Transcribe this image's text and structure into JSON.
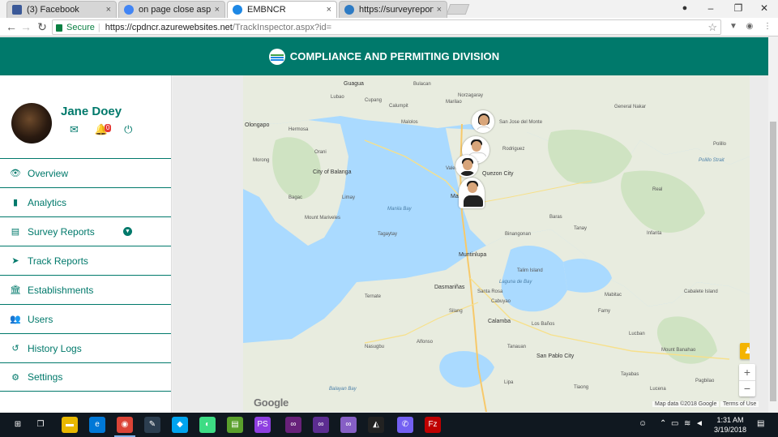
{
  "browser": {
    "tabs": [
      {
        "label": "(3) Facebook",
        "favicon": "facebook-icon",
        "color": "#3b5998"
      },
      {
        "label": "on page close asp.net - G",
        "favicon": "google-icon",
        "color": "#4285f4"
      },
      {
        "label": "EMBNCR",
        "favicon": "emb-logo-icon",
        "color": "#1e88e5"
      },
      {
        "label": "https://surveyreportform",
        "favicon": "globe-icon",
        "color": "#2e7bc4"
      }
    ],
    "tab_close": "×",
    "window_controls": {
      "minimize": "–",
      "maximize": "❐",
      "close": "✕"
    },
    "address": {
      "secure_label": "Secure",
      "host": "https://cpdncr.azurewebsites.net",
      "path": "/TrackInspector.aspx?id="
    }
  },
  "header": {
    "title": "COMPLIANCE AND PERMITING DIVISION"
  },
  "user": {
    "name": "Jane Doey",
    "notification_count": "0"
  },
  "menu": [
    {
      "label": "Overview",
      "icon": "👁"
    },
    {
      "label": "Analytics",
      "icon": "▮"
    },
    {
      "label": "Survey Reports",
      "icon": "▤"
    },
    {
      "label": "Track Reports",
      "icon": "➤"
    },
    {
      "label": "Establishments",
      "icon": "🏛"
    },
    {
      "label": "Users",
      "icon": "👥"
    },
    {
      "label": "History Logs",
      "icon": "↺"
    },
    {
      "label": "Settings",
      "icon": "⚙"
    }
  ],
  "map": {
    "labels": [
      {
        "text": "Guagua",
        "cls": "big"
      },
      {
        "text": "Bulacan",
        "cls": ""
      },
      {
        "text": "Lubao",
        "cls": ""
      },
      {
        "text": "Cupang",
        "cls": ""
      },
      {
        "text": "Calumpit",
        "cls": ""
      },
      {
        "text": "Marilao",
        "cls": ""
      },
      {
        "text": "Olongapo",
        "cls": "big"
      },
      {
        "text": "Hermosa",
        "cls": ""
      },
      {
        "text": "Malolos",
        "cls": ""
      },
      {
        "text": "Norzagaray",
        "cls": ""
      },
      {
        "text": "San Jose del Monte",
        "cls": ""
      },
      {
        "text": "Rodriguez",
        "cls": ""
      },
      {
        "text": "Orani",
        "cls": ""
      },
      {
        "text": "Morong",
        "cls": ""
      },
      {
        "text": "City of Balanga",
        "cls": "big"
      },
      {
        "text": "Valenzuela",
        "cls": ""
      },
      {
        "text": "Quezon City",
        "cls": "big"
      },
      {
        "text": "Bagac",
        "cls": ""
      },
      {
        "text": "Limay",
        "cls": ""
      },
      {
        "text": "Manila Bay",
        "cls": "water"
      },
      {
        "text": "Mount Mariveles",
        "cls": ""
      },
      {
        "text": "Makati",
        "cls": "big"
      },
      {
        "text": "Baras",
        "cls": ""
      },
      {
        "text": "Tanay",
        "cls": ""
      },
      {
        "text": "Tagaytay",
        "cls": ""
      },
      {
        "text": "Binangonan",
        "cls": ""
      },
      {
        "text": "Muntinlupa",
        "cls": "big"
      },
      {
        "text": "Talim Island",
        "cls": ""
      },
      {
        "text": "Laguna de Bay",
        "cls": "water"
      },
      {
        "text": "General Nakar",
        "cls": ""
      },
      {
        "text": "Real",
        "cls": ""
      },
      {
        "text": "Polillo",
        "cls": ""
      },
      {
        "text": "Polillo Strait",
        "cls": "water"
      },
      {
        "text": "Infanta",
        "cls": ""
      },
      {
        "text": "Dasmariñas",
        "cls": "big"
      },
      {
        "text": "Santa Rosa",
        "cls": ""
      },
      {
        "text": "Cabuyao",
        "cls": ""
      },
      {
        "text": "Silang",
        "cls": ""
      },
      {
        "text": "Calamba",
        "cls": "big"
      },
      {
        "text": "Los Baños",
        "cls": ""
      },
      {
        "text": "Mabitac",
        "cls": ""
      },
      {
        "text": "Famy",
        "cls": ""
      },
      {
        "text": "Ternate",
        "cls": ""
      },
      {
        "text": "Cabalete Island",
        "cls": ""
      },
      {
        "text": "Nasugbu",
        "cls": ""
      },
      {
        "text": "Alfonso",
        "cls": ""
      },
      {
        "text": "Tanauan",
        "cls": ""
      },
      {
        "text": "San Pablo City",
        "cls": "big"
      },
      {
        "text": "Mount Banahao",
        "cls": ""
      },
      {
        "text": "Lucban",
        "cls": ""
      },
      {
        "text": "Pagbilao",
        "cls": ""
      },
      {
        "text": "Lucena",
        "cls": ""
      },
      {
        "text": "Lipa",
        "cls": ""
      },
      {
        "text": "Tiaong",
        "cls": ""
      },
      {
        "text": "Balayan Bay",
        "cls": "water"
      },
      {
        "text": "Tayabas",
        "cls": ""
      }
    ],
    "inspectors": [
      "inspector-1",
      "inspector-2",
      "inspector-3",
      "inspector-4"
    ],
    "google_label": "Google",
    "zoom_in": "+",
    "zoom_out": "−",
    "attribution": "Map data ©2018 Google",
    "terms": "Terms of Use"
  },
  "taskbar": {
    "time": "1:31 AM",
    "date": "3/19/2018",
    "apps": [
      {
        "icon": "windows-start-icon",
        "glyph": "⊞",
        "color": "#101820"
      },
      {
        "icon": "task-view-icon",
        "glyph": "❐",
        "color": "#101820"
      },
      {
        "icon": "file-explorer-icon",
        "glyph": "▬",
        "color": "#e8b800"
      },
      {
        "icon": "edge-icon",
        "glyph": "e",
        "color": "#0078d7"
      },
      {
        "icon": "chrome-icon",
        "glyph": "◉",
        "color": "#db4437"
      },
      {
        "icon": "tools-icon",
        "glyph": "✎",
        "color": "#2c3e50"
      },
      {
        "icon": "app-blue-icon",
        "glyph": "◆",
        "color": "#00a4ef"
      },
      {
        "icon": "android-icon",
        "glyph": "◐",
        "color": "#3ddc84"
      },
      {
        "icon": "notepad-icon",
        "glyph": "▤",
        "color": "#5aa02c"
      },
      {
        "icon": "phpstorm-icon",
        "glyph": "PS",
        "color": "#8e3ee0"
      },
      {
        "icon": "visual-studio-icon",
        "glyph": "∞",
        "color": "#68217a"
      },
      {
        "icon": "visual-studio-2-icon",
        "glyph": "∞",
        "color": "#5c2d91"
      },
      {
        "icon": "visual-studio-3-icon",
        "glyph": "∞",
        "color": "#865fc5"
      },
      {
        "icon": "unity-icon",
        "glyph": "◭",
        "color": "#222"
      },
      {
        "icon": "viber-icon",
        "glyph": "✆",
        "color": "#7360f2"
      },
      {
        "icon": "filezilla-icon",
        "glyph": "Fz",
        "color": "#bf0000"
      }
    ]
  }
}
